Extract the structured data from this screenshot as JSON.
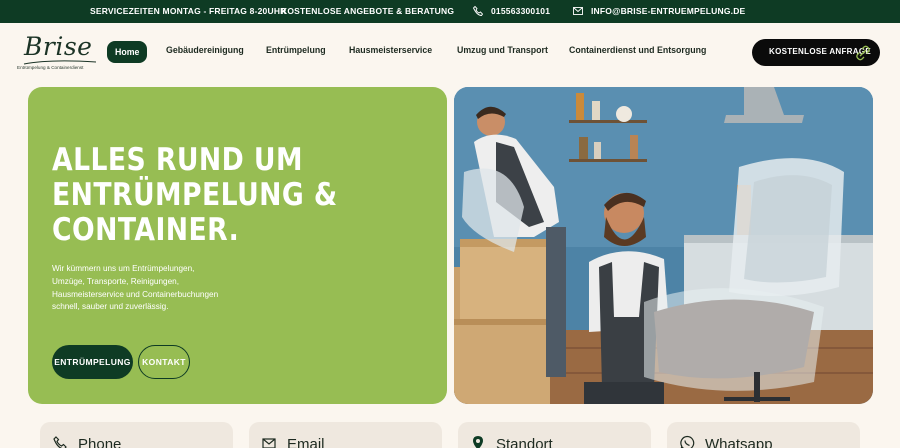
{
  "topbar": {
    "service_hours": "SERVICEZEITEN MONTAG - FREITAG 8-20UHR",
    "free_offers": "KOSTENLOSE ANGEBOTE & BERATUNG",
    "phone": "015563300101",
    "email": "INFO@BRISE-ENTRUEMPELUNG.DE",
    "background_color": "#0e3b24"
  },
  "brand": {
    "name": "Brise",
    "tagline": "Entrümpelung & Containerdienst"
  },
  "nav": {
    "items": [
      {
        "label": "Home",
        "active": true
      },
      {
        "label": "Gebäudereinigung",
        "active": false
      },
      {
        "label": "Entrümpelung",
        "active": false
      },
      {
        "label": "Hausmeisterservice",
        "active": false
      },
      {
        "label": "Umzug und Transport",
        "active": false
      },
      {
        "label": "Containerdienst und Entsorgung",
        "active": false
      }
    ],
    "cta_label": "KOSTENLOSE ANFRAGE"
  },
  "hero": {
    "title_lines": [
      "ALLES RUND UM",
      "ENTRÜMPELUNG &",
      "CONTAINER."
    ],
    "description_lines": [
      "Wir kümmern uns um Entrümpelungen,",
      "Umzüge, Transporte, Reinigungen,",
      "Hausmeisterservice und Containerbuchungen",
      "schnell, sauber und zuverlässig."
    ],
    "primary_button": "ENTRÜMPELUNG",
    "secondary_button": "KONTAKT",
    "accent_color": "#97bd53"
  },
  "contact_cards": [
    {
      "label": "Phone",
      "icon": "phone-icon"
    },
    {
      "label": "Email",
      "icon": "email-icon"
    },
    {
      "label": "Standort",
      "icon": "location-pin-icon"
    },
    {
      "label": "Whatsapp",
      "icon": "whatsapp-icon"
    }
  ]
}
